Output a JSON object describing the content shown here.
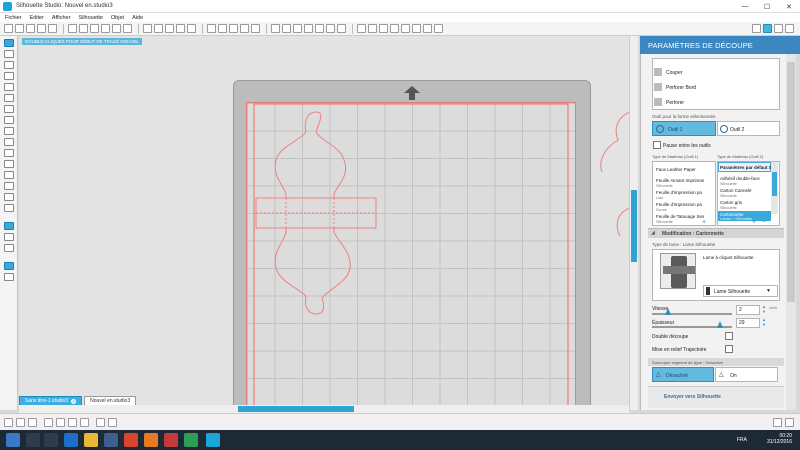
{
  "window": {
    "title": "Silhouette Studio: Nouvel en.studio3",
    "min": "—",
    "max": "☐",
    "close": "✕"
  },
  "menu": [
    "Fichier",
    "Editer",
    "Afficher",
    "Silhouette",
    "Objet",
    "Aide"
  ],
  "canvas": {
    "hint": "DOUBLE-CLIQUEZ POUR DÉBUT DE TRACÉ NOUVEL"
  },
  "tabs": [
    {
      "label": "Sans titre-1.studio3",
      "active": true
    },
    {
      "label": "Nouvel en.studio3",
      "active": false
    }
  ],
  "panel": {
    "title": "PARAMÈTRES DE DÉCOUPE",
    "modes": [
      "Couper",
      "Perforer Bord",
      "Perforer"
    ],
    "tool_section_label": "Outil pour la forme sélectionnée",
    "tool1": "Outil 1",
    "tool2": "Outil 2",
    "pause_label": "Pause entre les outils",
    "material_label_1": "Type de Matériau (Outil 1)",
    "material_label_2": "Type de Matériau (Outil 2)",
    "materials_left": [
      {
        "name": "Faux Leather Paper",
        "sub": ""
      },
      {
        "name": "Feuille Aimant Impriman",
        "sub": "Silhouette"
      },
      {
        "name": "Feuille d'impression pa",
        "sub": "Liari"
      },
      {
        "name": "Feuille d'impression pa",
        "sub": "Scrme"
      },
      {
        "name": "Feuille de Tatouage Ses",
        "sub": "Silhouette"
      }
    ],
    "materials_right_header": "Paramètres par défaut S",
    "materials_right": [
      {
        "name": "Adhésif double-face",
        "sub": "Silhouette"
      },
      {
        "name": "Carton Cannelé",
        "sub": "Silhouette"
      },
      {
        "name": "Carton gris",
        "sub": "Silhouette"
      },
      {
        "name": "Cartonnette",
        "sub": "Loisirs + Silhouette",
        "selected": true
      }
    ],
    "modification": "Modification : Cartonnette",
    "blade_type_label": "Type de lame : Lame Silhouette",
    "blade_desc": "Lame à cliquet Silhouette",
    "blade_select": "Lame Silhouette",
    "speed_label": "Vitesse",
    "speed_value": "2",
    "speed_unit": "cm/s",
    "speed_fraction": 0.2,
    "thickness_label": "Épaisseur",
    "thickness_value": "29",
    "thickness_fraction": 0.85,
    "double_cut": "Double découpe",
    "track_enhance": "Mise en relief Trajectoire",
    "overcut_label": "Surcouper segment de ligne : Désactivé",
    "overcut_off": "Désactivé",
    "overcut_on": "On",
    "send_button": "Envoyer vers Silhouette"
  },
  "taskbar": {
    "lang": "FRA",
    "time": "00:20",
    "date": "31/12/2016"
  }
}
